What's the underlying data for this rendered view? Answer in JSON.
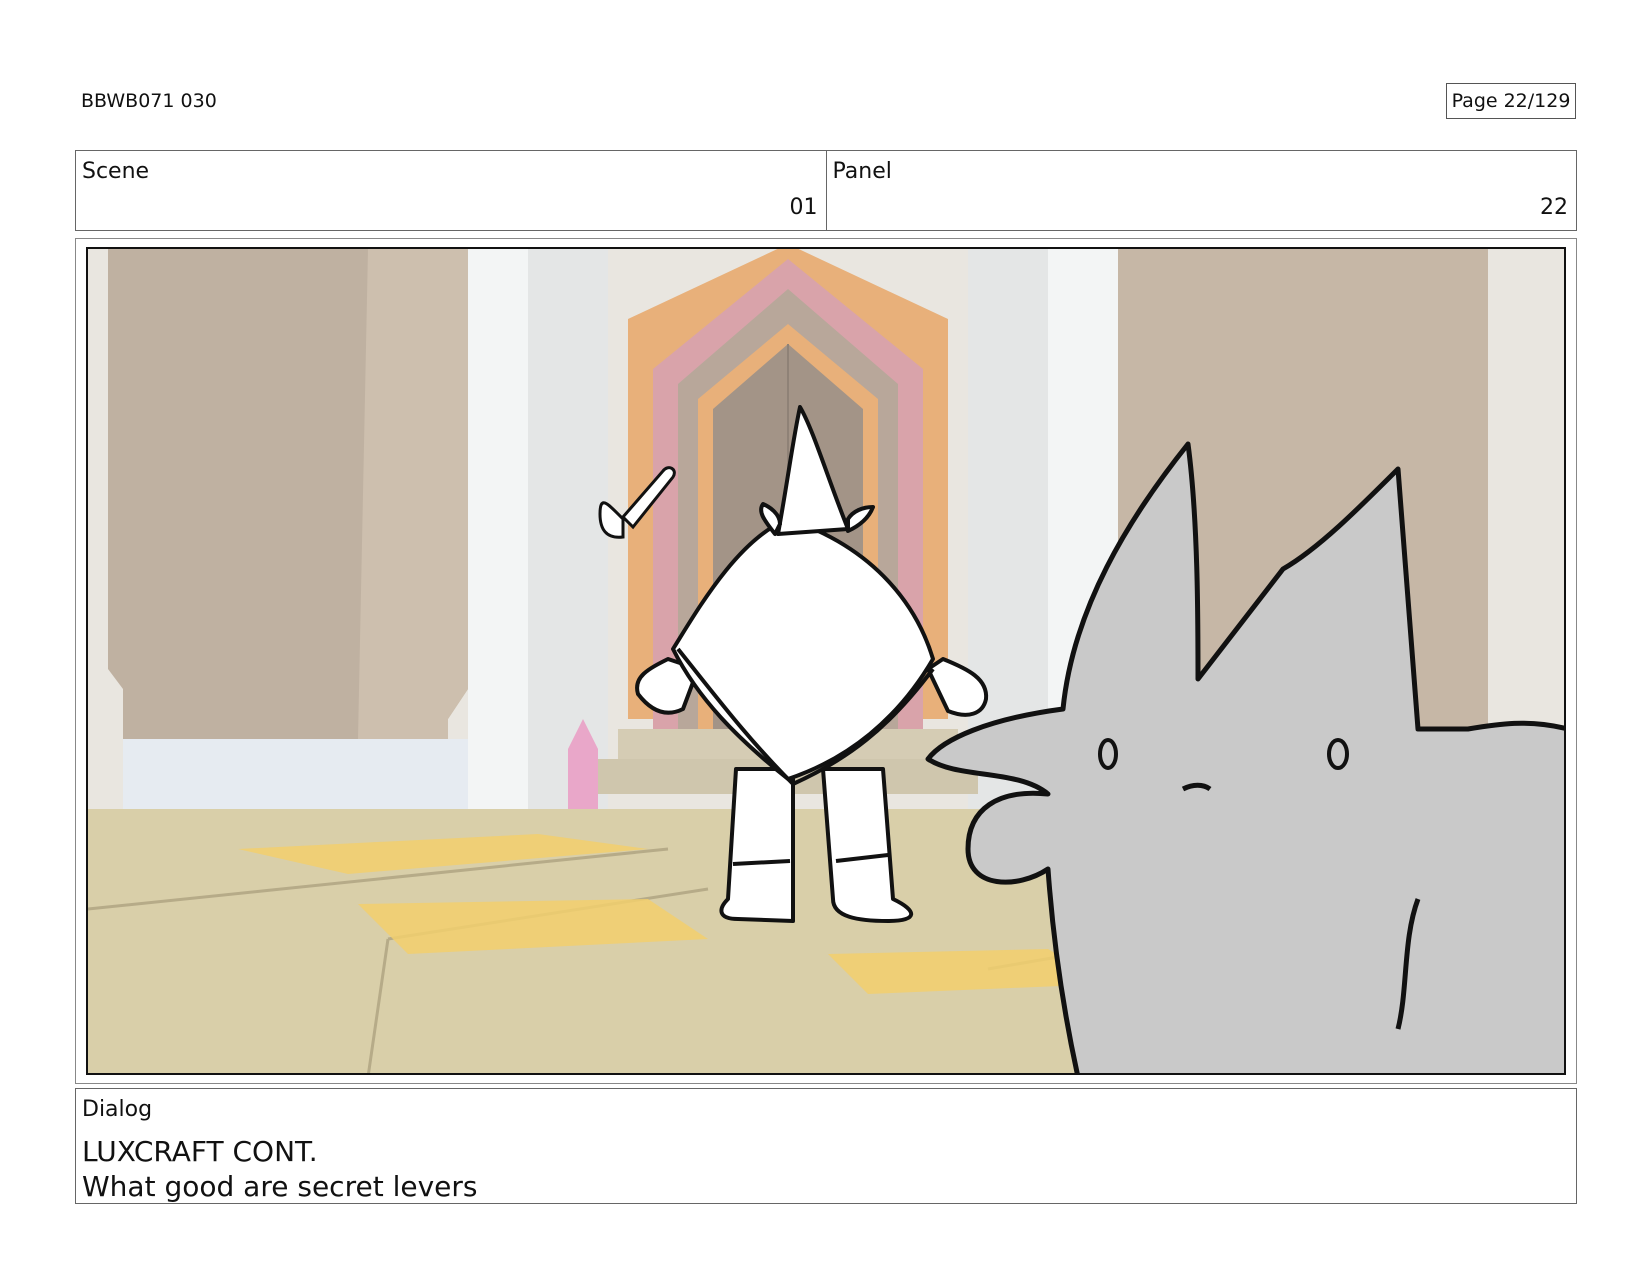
{
  "document": {
    "id": "BBWB071 030",
    "page_label": "Page",
    "page_number": "22/129"
  },
  "scene": {
    "label": "Scene",
    "value": "01"
  },
  "panel": {
    "label": "Panel",
    "value": "22"
  },
  "dialog": {
    "label": "Dialog",
    "lines": [
      "LUXCRAFT CONT.",
      "What good are secret levers"
    ]
  },
  "colors": {
    "floor": "#d9cfa9",
    "wall": "#d2c7b9",
    "pillar": "#eef0f0",
    "door_pink": "#d9a3aa",
    "door_orange": "#e8b07a",
    "gold_tile": "#f2cf6d",
    "creature_gray": "#c9c9c9"
  }
}
